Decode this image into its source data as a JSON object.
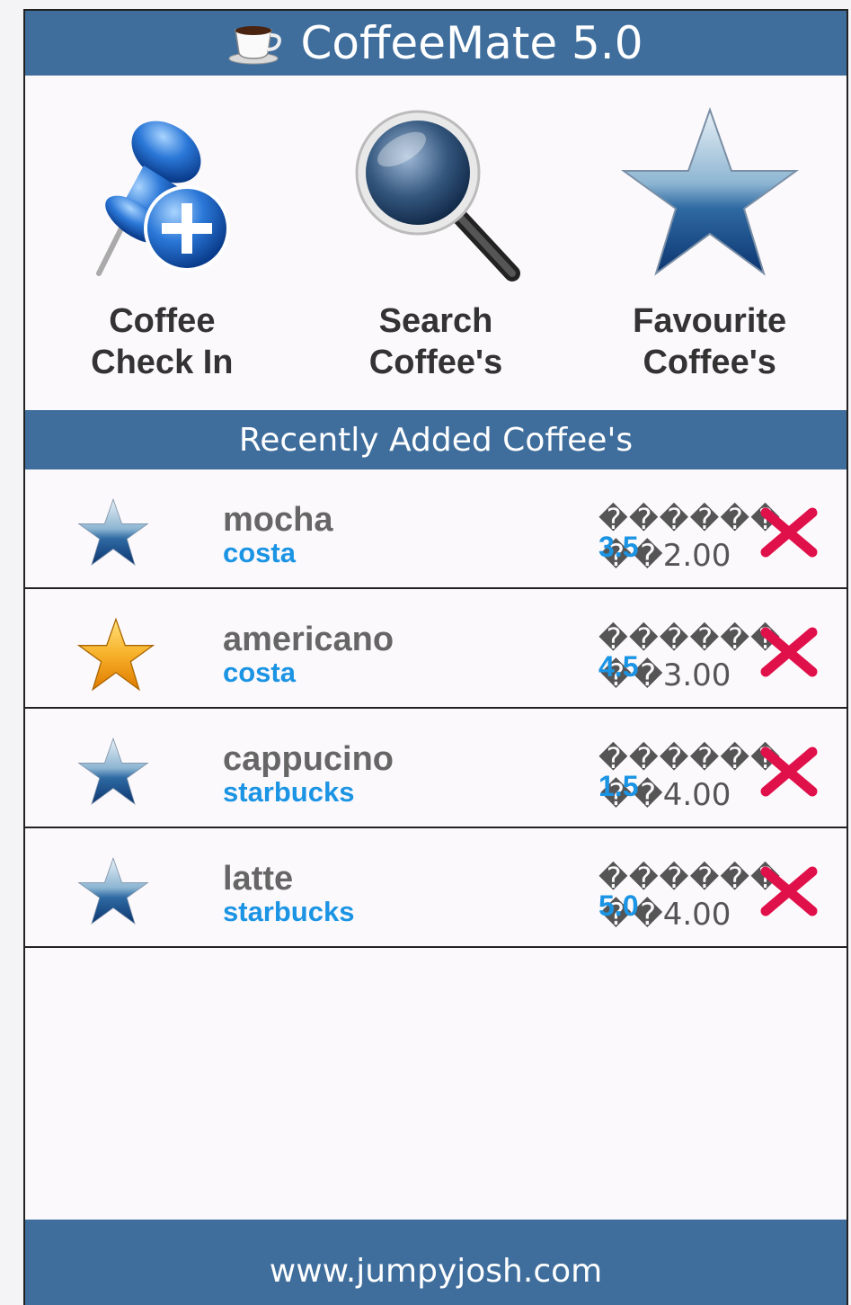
{
  "header": {
    "title": "CoffeeMate 5.0",
    "icon": "coffee-cup-icon"
  },
  "actions": [
    {
      "line1": "Coffee",
      "line2": "Check In",
      "icon": "pushpin-add-icon"
    },
    {
      "line1": "Search",
      "line2": "Coffee's",
      "icon": "magnifier-icon"
    },
    {
      "line1": "Favourite",
      "line2": "Coffee's",
      "icon": "star-icon"
    }
  ],
  "section": {
    "title": "Recently Added Coffee's"
  },
  "coffees": [
    {
      "name": "mocha",
      "shop": "costa",
      "rating": "3.5",
      "price": "2.00",
      "favourite": false,
      "garbled": "������"
    },
    {
      "name": "americano",
      "shop": "costa",
      "rating": "4.5",
      "price": "3.00",
      "favourite": true,
      "garbled": "������"
    },
    {
      "name": "cappucino",
      "shop": "starbucks",
      "rating": "1.5",
      "price": "4.00",
      "favourite": false,
      "garbled": "������"
    },
    {
      "name": "latte",
      "shop": "starbucks",
      "rating": "5.0",
      "price": "4.00",
      "favourite": false,
      "garbled": "������"
    }
  ],
  "footer": {
    "text": "www.jumpyjosh.com"
  },
  "colors": {
    "bar": "#3f6e9d",
    "link": "#1b94e4",
    "delete": "#e0104a",
    "gold": "#f5a418"
  }
}
